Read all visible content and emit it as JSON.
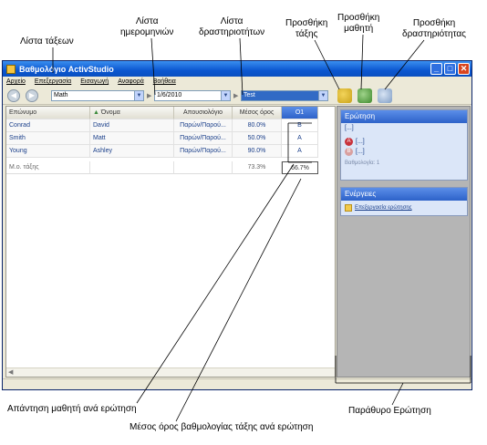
{
  "callouts": {
    "class_list": "Λίστα τάξεων",
    "date_list_1": "Λίστα",
    "date_list_2": "ημερομηνιών",
    "activity_list_1": "Λίστα",
    "activity_list_2": "δραστηριοτήτων",
    "add_class_1": "Προσθήκη",
    "add_class_2": "τάξης",
    "add_student_1": "Προσθήκη",
    "add_student_2": "μαθητή",
    "add_activity_1": "Προσθήκη",
    "add_activity_2": "δραστηριότητας",
    "answer_per_question": "Απάντηση μαθητή ανά ερώτηση",
    "class_avg_per_question": "Μέσος όρος βαθμολογίας τάξης ανά ερώτηση",
    "question_window": "Παράθυρο Ερώτηση"
  },
  "window": {
    "title": "Βαθμολόγιο ActivStudio",
    "min": "_",
    "max": "□",
    "close": "✕"
  },
  "menu": [
    "Αρχείο",
    "Επεξεργασία",
    "Εισαγωγή",
    "Αναφορά",
    "Βοήθεια"
  ],
  "toolbar": {
    "back": "◀",
    "forward": "▶",
    "class_value": "Math",
    "date_value": "1/6/2010",
    "activity_value": "Test",
    "arrow": "▼",
    "sep": "▶"
  },
  "grid": {
    "headers": {
      "last": "Επώνυμο",
      "first": "Όνομα",
      "absence": "Απουσιολόγιο",
      "avg": "Μέσος όρος",
      "q1": "Ο1",
      "sort_icon": "▲"
    },
    "rows": [
      {
        "last": "Conrad",
        "first": "David",
        "absence": "Παρών/Παρού...",
        "avg": "80.0%",
        "q1": "B"
      },
      {
        "last": "Smith",
        "first": "Matt",
        "absence": "Παρών/Παρού...",
        "avg": "50.0%",
        "q1": "A"
      },
      {
        "last": "Young",
        "first": "Ashley",
        "absence": "Παρών/Παρού...",
        "avg": "90.0%",
        "q1": "A"
      }
    ],
    "avg_row": {
      "label": "Μ.ο. τάξης",
      "avg": "73.3%",
      "q1": "66.7%"
    },
    "scroll_left": "◀"
  },
  "question_panel": {
    "title": "Ερώτηση",
    "text": "[...]",
    "options": [
      {
        "letter": "A",
        "text": "[...]",
        "color": "#c8323c"
      },
      {
        "letter": "B",
        "text": "[...]",
        "color": "#d9a0a0"
      }
    ],
    "score": "Βαθμολογία: 1"
  },
  "actions_panel": {
    "title": "Ενέργειες",
    "edit_question": "Επεξεργασία ερώτησης"
  },
  "colors": {
    "accent": "#2d62c9",
    "panel_bg": "#b5b5b5"
  }
}
